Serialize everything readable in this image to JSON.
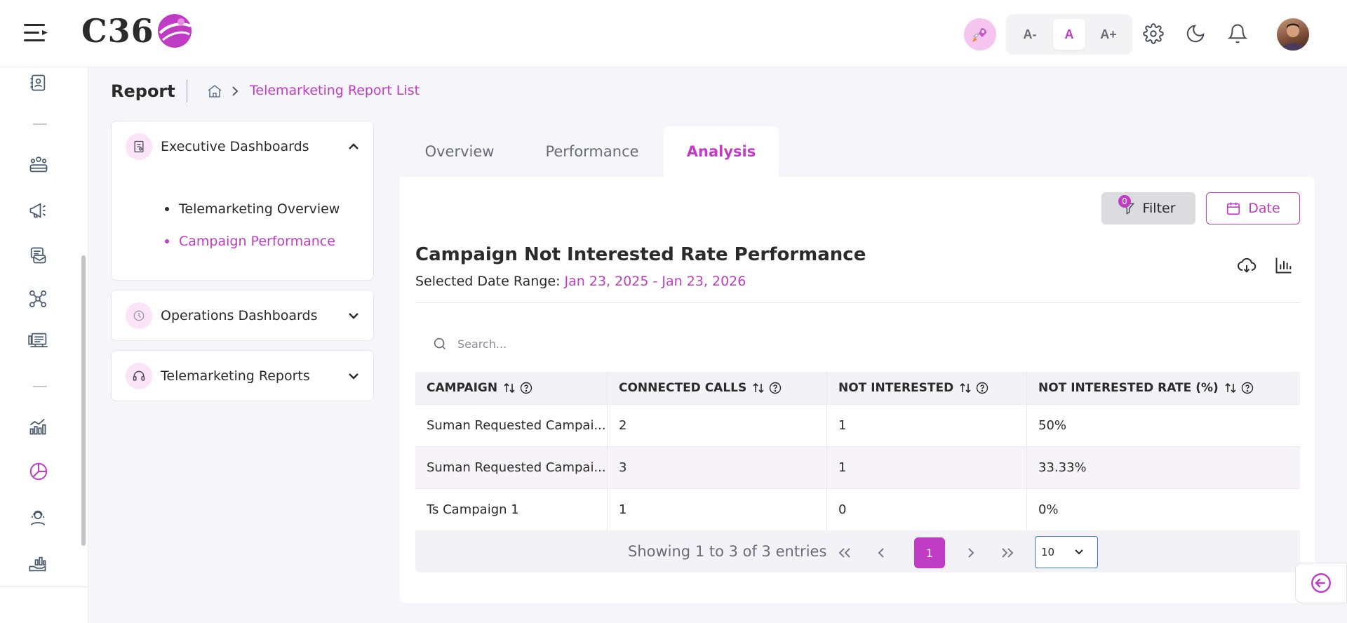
{
  "header": {
    "logo_text": "C36",
    "font_controls": [
      "A-",
      "A",
      "A+"
    ],
    "active_font": "A",
    "icons": [
      "menu-icon",
      "rocket-icon",
      "gear-icon",
      "moon-icon",
      "bell-icon"
    ]
  },
  "rail": {
    "icons": [
      "contact-book-icon",
      "team-icon",
      "megaphone-icon",
      "inbox-icon",
      "workflow-icon",
      "monitor-icon",
      "analytics-icon",
      "pie-chart-icon",
      "support-agent-icon",
      "hand-chart-icon"
    ]
  },
  "breadcrumb": {
    "page_title": "Report",
    "current": "Telemarketing Report List"
  },
  "sidebar": {
    "panels": [
      {
        "label": "Executive Dashboards",
        "expanded": true,
        "items": [
          {
            "label": "Telemarketing Overview",
            "active": false
          },
          {
            "label": "Campaign Performance",
            "active": true
          }
        ]
      },
      {
        "label": "Operations Dashboards",
        "expanded": false
      },
      {
        "label": "Telemarketing Reports",
        "expanded": false
      }
    ]
  },
  "tabs": [
    {
      "label": "Overview",
      "active": false
    },
    {
      "label": "Performance",
      "active": false
    },
    {
      "label": "Analysis",
      "active": true
    }
  ],
  "toolbar": {
    "filter_label": "Filter",
    "filter_count": "0",
    "date_label": "Date"
  },
  "report": {
    "title": "Campaign Not Interested Rate Performance",
    "range_label": "Selected Date Range:",
    "range_value": "Jan 23, 2025 - Jan 23, 2026"
  },
  "search": {
    "placeholder": "Search..."
  },
  "table": {
    "columns": [
      "CAMPAIGN",
      "CONNECTED CALLS",
      "NOT INTERESTED",
      "NOT INTERESTED RATE (%)"
    ],
    "rows": [
      [
        "Suman Requested Campai...",
        "2",
        "1",
        "50%"
      ],
      [
        "Suman Requested Campai...",
        "3",
        "1",
        "33.33%"
      ],
      [
        "Ts Campaign 1",
        "1",
        "0",
        "0%"
      ]
    ]
  },
  "pagination": {
    "info": "Showing 1 to 3 of 3 entries",
    "current_page": "1",
    "page_size": "10"
  },
  "colors": {
    "accent": "#c13cc4",
    "accent_soft": "#fbe3f8",
    "background": "#f5f5fa"
  }
}
